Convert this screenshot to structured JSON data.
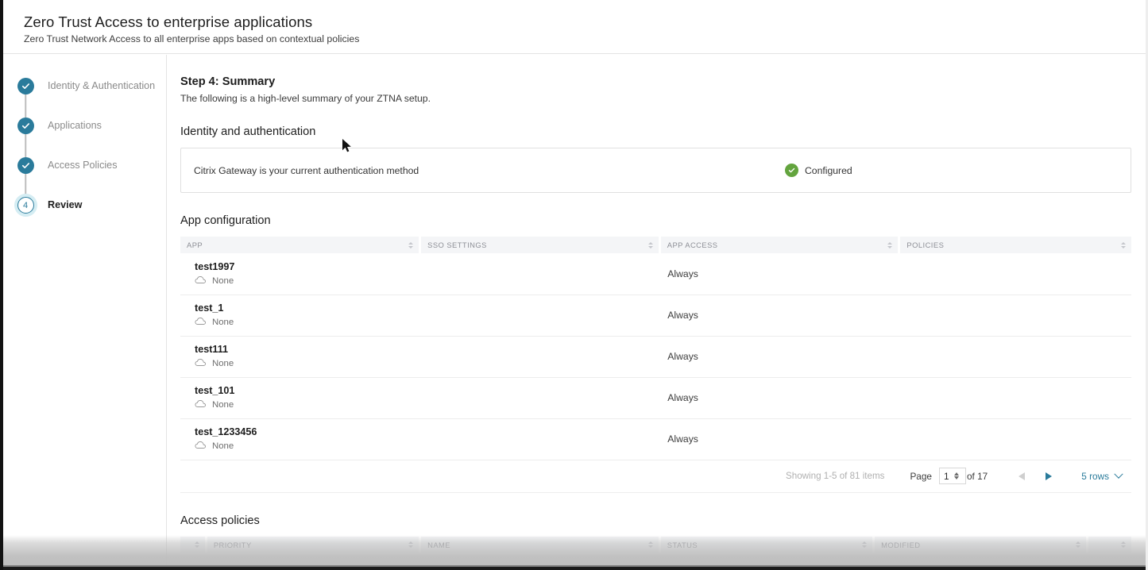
{
  "header": {
    "title": "Zero Trust Access to enterprise applications",
    "subtitle": "Zero Trust Network Access to all enterprise apps based on contextual policies"
  },
  "sidebar": {
    "steps": [
      {
        "label": "Identity & Authentication",
        "state": "complete",
        "marker": "check-icon"
      },
      {
        "label": "Applications",
        "state": "complete",
        "marker": "check-icon"
      },
      {
        "label": "Access Policies",
        "state": "complete",
        "marker": "check-icon"
      },
      {
        "label": "Review",
        "state": "current",
        "marker": "4"
      }
    ]
  },
  "main": {
    "step_title": "Step 4: Summary",
    "step_desc": "The following is a high-level summary of your ZTNA setup.",
    "identity": {
      "section_title": "Identity and authentication",
      "method_text": "Citrix Gateway is your current authentication method",
      "status_text": "Configured",
      "status_icon": "green-check-icon",
      "status_color": "#63a43e"
    },
    "app_config": {
      "section_title": "App configuration",
      "columns": [
        "APP",
        "SSO SETTINGS",
        "APP ACCESS",
        "POLICIES"
      ],
      "rows": [
        {
          "app": "test1997",
          "sso": "None",
          "sso_icon": "cloud-icon",
          "access": "Always",
          "policies": ""
        },
        {
          "app": "test_1",
          "sso": "None",
          "sso_icon": "cloud-icon",
          "access": "Always",
          "policies": ""
        },
        {
          "app": "test111",
          "sso": "None",
          "sso_icon": "cloud-icon",
          "access": "Always",
          "policies": ""
        },
        {
          "app": "test_101",
          "sso": "None",
          "sso_icon": "cloud-icon",
          "access": "Always",
          "policies": ""
        },
        {
          "app": "test_1233456",
          "sso": "None",
          "sso_icon": "cloud-icon",
          "access": "Always",
          "policies": ""
        }
      ],
      "pagination": {
        "showing": "Showing 1-5 of 81 items",
        "page_label": "Page",
        "page_value": "1",
        "of_text": "of 17",
        "prev_icon": "triangle-left-icon",
        "next_icon": "triangle-right-icon",
        "rows_label": "5 rows",
        "rows_chevron": "chevron-down-icon"
      }
    },
    "access_policies": {
      "section_title": "Access policies",
      "columns": [
        "PRIORITY",
        "NAME",
        "STATUS",
        "MODIFIED"
      ]
    }
  },
  "colors": {
    "accent": "#2a7b9b",
    "success": "#63a43e",
    "header_bg": "#f4f5f7"
  }
}
